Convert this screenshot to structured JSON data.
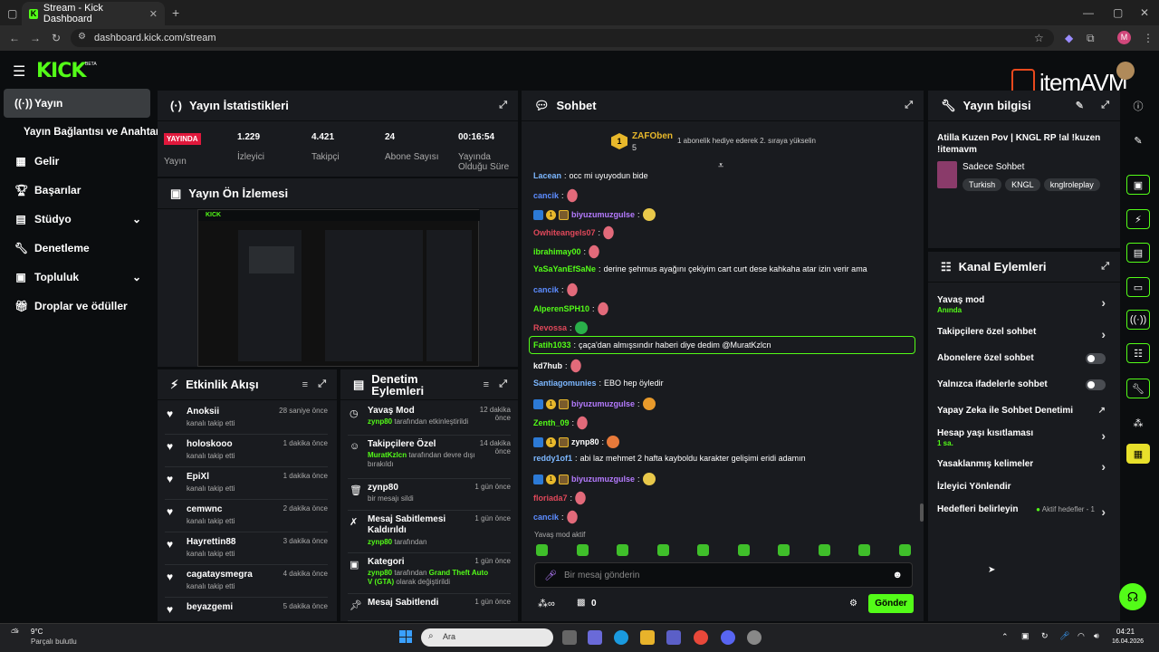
{
  "browser": {
    "tab_title": "Stream - Kick Dashboard",
    "url": "dashboard.kick.com/stream",
    "profile": "M"
  },
  "brand": {
    "logo": "KICK",
    "beta": "BETA",
    "overlay": "itemAVM"
  },
  "sidebar": [
    {
      "label": "Yayın",
      "icon": "broadcast-icon"
    },
    {
      "label": "Yayın Bağlantısı ve Anahtarı",
      "icon": ""
    },
    {
      "label": "Gelir",
      "icon": "chart-icon"
    },
    {
      "label": "Başarılar",
      "icon": "trophy-icon"
    },
    {
      "label": "Stüdyo",
      "icon": "studio-icon"
    },
    {
      "label": "Denetleme",
      "icon": "wrench-icon"
    },
    {
      "label": "Topluluk",
      "icon": "community-icon"
    },
    {
      "label": "Droplar ve ödüller",
      "icon": "gift-icon"
    }
  ],
  "stats": {
    "title": "Yayın İstatistikleri",
    "live": "YAYINDA",
    "live_label": "Yayın",
    "items": [
      {
        "value": "1.229",
        "label": "İzleyici"
      },
      {
        "value": "4.421",
        "label": "Takipçi"
      },
      {
        "value": "24",
        "label": "Abone Sayısı"
      },
      {
        "value": "00:16:54",
        "label": "Yayında Olduğu Süre"
      }
    ]
  },
  "preview": {
    "title": "Yayın Ön İzlemesi"
  },
  "events": {
    "title": "Etkinlik Akışı",
    "items": [
      {
        "name": "Anoksii",
        "sub": "kanalı takip etti",
        "time": "28 saniye önce"
      },
      {
        "name": "holoskooo",
        "sub": "kanalı takip etti",
        "time": "1 dakika önce"
      },
      {
        "name": "EpiXl",
        "sub": "kanalı takip etti",
        "time": "1 dakika önce"
      },
      {
        "name": "cemwnc",
        "sub": "kanalı takip etti",
        "time": "2 dakika önce"
      },
      {
        "name": "Hayrettin88",
        "sub": "kanalı takip etti",
        "time": "3 dakika önce"
      },
      {
        "name": "cagataysmegra",
        "sub": "kanalı takip etti",
        "time": "4 dakika önce"
      },
      {
        "name": "beyazgemi",
        "sub": "",
        "time": "5 dakika önce"
      }
    ]
  },
  "moderation": {
    "title": "Denetim Eylemleri",
    "items": [
      {
        "name": "Yavaş Mod",
        "user": "zynp80",
        "sub": "tarafından etkinleştirildi",
        "time": "12 dakika önce"
      },
      {
        "name": "Takipçilere Özel",
        "user": "MuratKzlcn",
        "sub": "tarafından devre dışı bırakıldı",
        "time": "14 dakika önce"
      },
      {
        "name": "zynp80",
        "user": "",
        "sub": "bir mesajı sildi",
        "time": "1 gün önce"
      },
      {
        "name": "Mesaj Sabitlemesi Kaldırıldı",
        "user": "zynp80",
        "sub": "tarafından",
        "time": "1 gün önce"
      },
      {
        "name": "Kategori",
        "user": "zynp80",
        "sub": "tarafından",
        "extra": "Grand Theft Auto V (GTA)",
        "sub2": "olarak değiştirildi",
        "time": "1 gün önce"
      },
      {
        "name": "Mesaj Sabitlendi",
        "user": "",
        "sub": "",
        "time": "1 gün önce"
      }
    ]
  },
  "chat": {
    "title": "Sohbet",
    "top_user": "ZAFOben",
    "top_count": "5",
    "top_note": "1 abonelik hediye ederek 2. sıraya yükselin",
    "slow_mode": "Yavaş mod aktif",
    "placeholder": "Bir mesaj gönderin",
    "count": "0",
    "send": "Gönder",
    "messages": [
      {
        "user": "Lacean",
        "color": "#7cb7ff",
        "text": "occ mi uyuyodun bide"
      },
      {
        "user": "cancik",
        "color": "#5c8cff",
        "text": ""
      },
      {
        "user": "biyuzumuzgulse",
        "color": "#b57bff",
        "text": ""
      },
      {
        "user": "Owhiteangels07",
        "color": "#e0485a",
        "text": ""
      },
      {
        "user": "ibrahimay00",
        "color": "#53fc18",
        "text": ""
      },
      {
        "user": "YaSaYanEfSaNe",
        "color": "#53fc18",
        "text": "derine şehmus ayağını çekiyim cart curt dese kahkaha atar izin verir ama"
      },
      {
        "user": "cancik",
        "color": "#5c8cff",
        "text": ""
      },
      {
        "user": "AlperenSPH10",
        "color": "#53fc18",
        "text": ""
      },
      {
        "user": "Revossa",
        "color": "#e0485a",
        "text": ""
      },
      {
        "user": "Fatih1033",
        "color": "#53fc18",
        "text": "çaça'dan almışsındır haberi diye dedim @MuratKzlcn"
      },
      {
        "user": "kd7hub",
        "color": "#fff",
        "text": ""
      },
      {
        "user": "Santiagomunies",
        "color": "#7cb7ff",
        "text": "EBO hep öyledir"
      },
      {
        "user": "biyuzumuzgulse",
        "color": "#b57bff",
        "text": ""
      },
      {
        "user": "Zenth_09",
        "color": "#53fc18",
        "text": ""
      },
      {
        "user": "zynp80",
        "color": "#fff",
        "text": ""
      },
      {
        "user": "reddy1of1",
        "color": "#7cb7ff",
        "text": "abi laz mehmet 2 hafta kayboldu karakter gelişimi eridi adamın"
      },
      {
        "user": "biyuzumuzgulse",
        "color": "#b57bff",
        "text": ""
      },
      {
        "user": "floriada7",
        "color": "#e0485a",
        "text": ""
      },
      {
        "user": "cancik",
        "color": "#5c8cff",
        "text": ""
      }
    ]
  },
  "info": {
    "title": "Yayın bilgisi",
    "stream_title": "Atilla Kuzen Pov | KNGL RP !al !kuzen !itemavm",
    "category": "Sadece Sohbet",
    "tags": [
      "Turkish",
      "KNGL",
      "knglroleplay"
    ]
  },
  "channel": {
    "title": "Kanal Eylemleri",
    "items": [
      {
        "label": "Yavaş mod",
        "sub": "Anında",
        "type": "arrow"
      },
      {
        "label": "Takipçilere özel sohbet",
        "sub": "",
        "type": "arrow"
      },
      {
        "label": "Abonelere özel sohbet",
        "sub": "",
        "type": "toggle"
      },
      {
        "label": "Yalnızca ifadelerle sohbet",
        "sub": "",
        "type": "toggle"
      },
      {
        "label": "Yapay Zeka ile Sohbet Denetimi",
        "sub": "",
        "type": "ext"
      },
      {
        "label": "Hesap yaşı kısıtlaması",
        "sub": "1 sa.",
        "type": "arrow"
      },
      {
        "label": "Yasaklanmış kelimeler",
        "sub": "",
        "type": "arrow"
      },
      {
        "label": "İzleyici Yönlendir",
        "sub": "",
        "type": "none"
      },
      {
        "label": "Hedefleri belirleyin",
        "sub": "",
        "status": "Aktif hedefler - 1",
        "type": "arrow"
      }
    ]
  },
  "taskbar": {
    "temp": "9°C",
    "weather": "Parçalı bulutlu",
    "search": "Ara",
    "time": "04:21",
    "date": "16.04.2026"
  }
}
